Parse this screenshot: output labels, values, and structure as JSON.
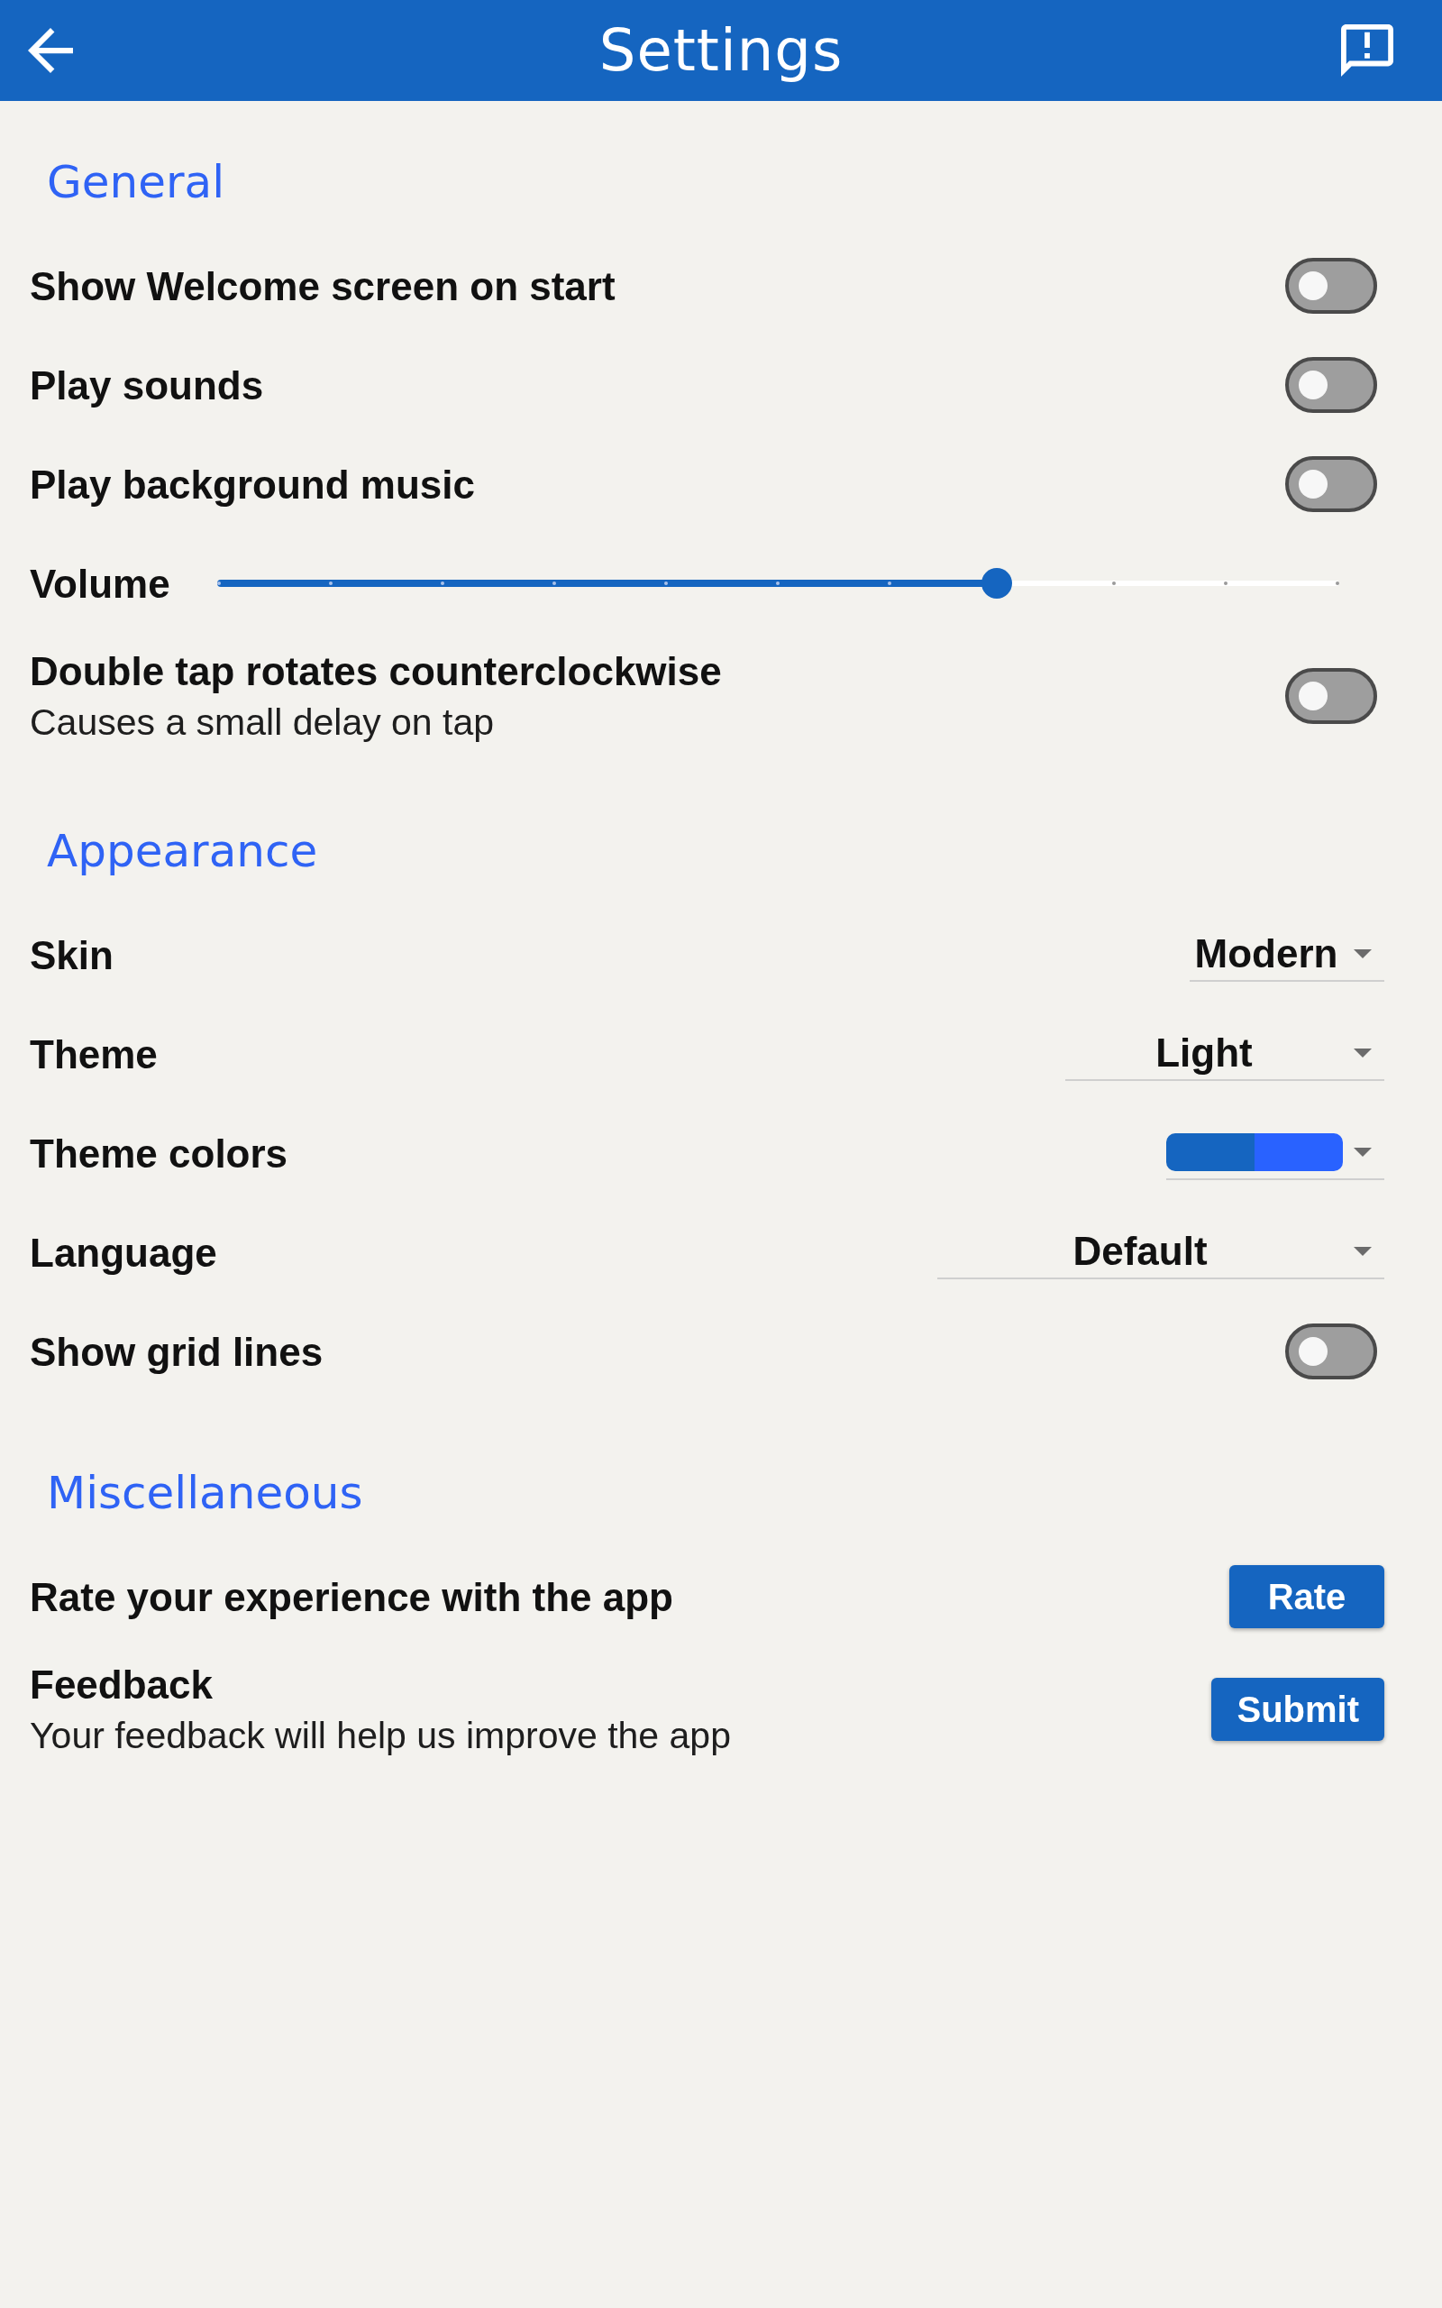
{
  "app_bar": {
    "title": "Settings"
  },
  "sections": [
    {
      "title": "General",
      "items": [
        {
          "kind": "toggle",
          "label": "Show Welcome screen on start",
          "on": false
        },
        {
          "kind": "toggle",
          "label": "Play sounds",
          "on": false
        },
        {
          "kind": "toggle",
          "label": "Play background music",
          "on": false
        },
        {
          "kind": "slider",
          "label": "Volume",
          "level": 0.7
        },
        {
          "kind": "toggle",
          "label": "Double tap rotates counterclockwise",
          "description": "Causes a small delay on tap",
          "on": false
        }
      ]
    },
    {
      "title": "Appearance",
      "items": [
        {
          "kind": "dropdown",
          "label": "Skin",
          "value": "Modern"
        },
        {
          "kind": "dropdown",
          "label": "Theme",
          "value": "Light"
        },
        {
          "kind": "color_dropdown",
          "label": "Theme colors",
          "swatches": [
            {
              "color": "#1565c0"
            },
            {
              "color": "#2962ff"
            }
          ]
        },
        {
          "kind": "dropdown",
          "label": "Language",
          "value": "Default"
        },
        {
          "kind": "toggle",
          "label": "Show grid lines",
          "on": false
        }
      ]
    },
    {
      "title": "Miscellaneous",
      "items": [
        {
          "kind": "button",
          "label": "Rate your experience with the app",
          "button": "Rate"
        },
        {
          "kind": "button",
          "label": "Feedback",
          "description": "Your feedback will help us improve the app",
          "button": "Submit"
        }
      ]
    }
  ]
}
